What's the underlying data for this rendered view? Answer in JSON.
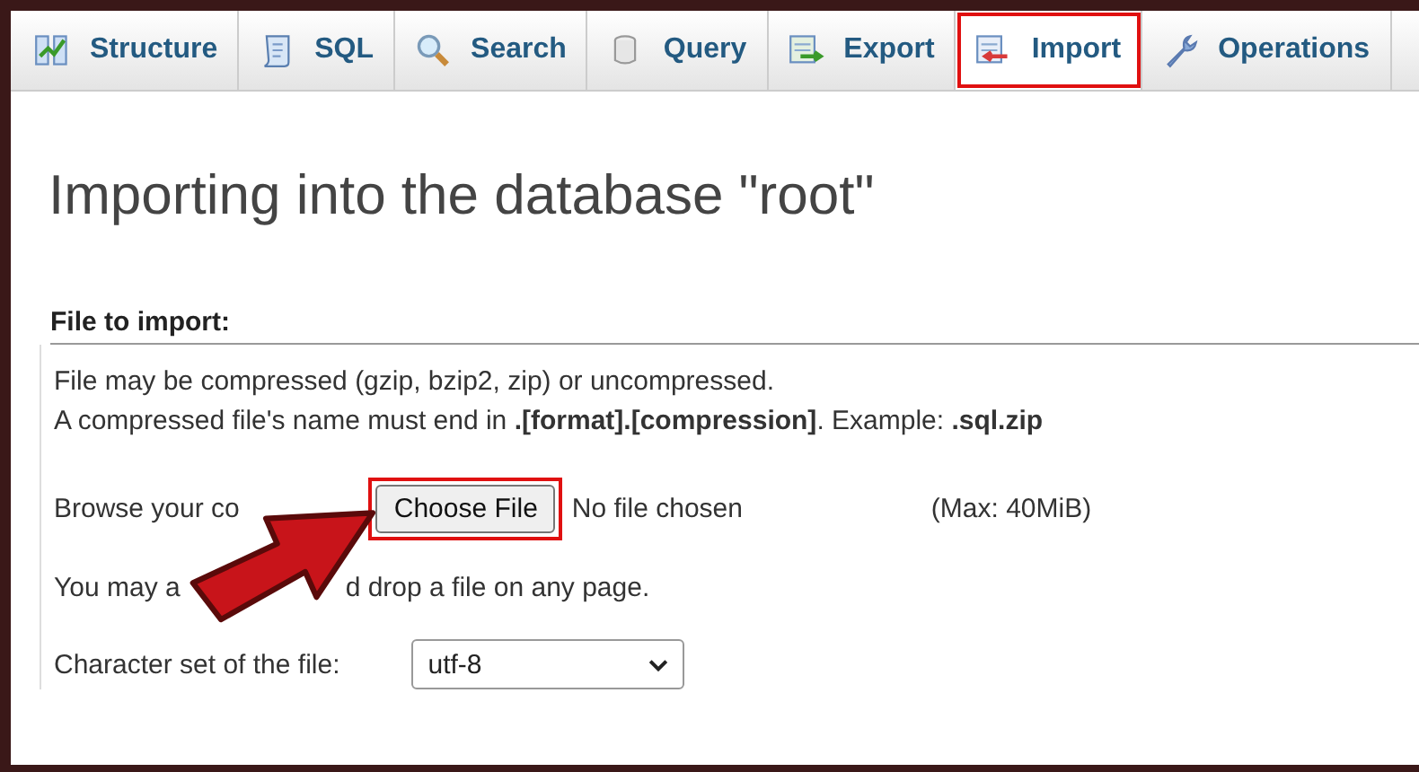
{
  "tabs": [
    {
      "label": "Structure",
      "selected": false,
      "highlighted": false
    },
    {
      "label": "SQL",
      "selected": false,
      "highlighted": false
    },
    {
      "label": "Search",
      "selected": false,
      "highlighted": false
    },
    {
      "label": "Query",
      "selected": false,
      "highlighted": false
    },
    {
      "label": "Export",
      "selected": false,
      "highlighted": false
    },
    {
      "label": "Import",
      "selected": true,
      "highlighted": true
    },
    {
      "label": "Operations",
      "selected": false,
      "highlighted": false
    }
  ],
  "heading": "Importing into the database \"root\"",
  "section": {
    "legend": "File to import:",
    "notes": [
      "File may be compressed (gzip, bzip2, zip) or uncompressed.",
      "A compressed file's name must end in **.[format].[compression]**. Example: **.sql.zip**"
    ],
    "browse": {
      "label": "Browse your co",
      "button": "Choose File",
      "button_highlighted": true,
      "status": "No file chosen",
      "max": "(Max: 40MiB)"
    },
    "drop_note": [
      "You may a",
      "d drop a file on any page."
    ],
    "charset": {
      "label": "Character set of the file:",
      "value": "utf-8"
    }
  },
  "pointer_arrow": true
}
